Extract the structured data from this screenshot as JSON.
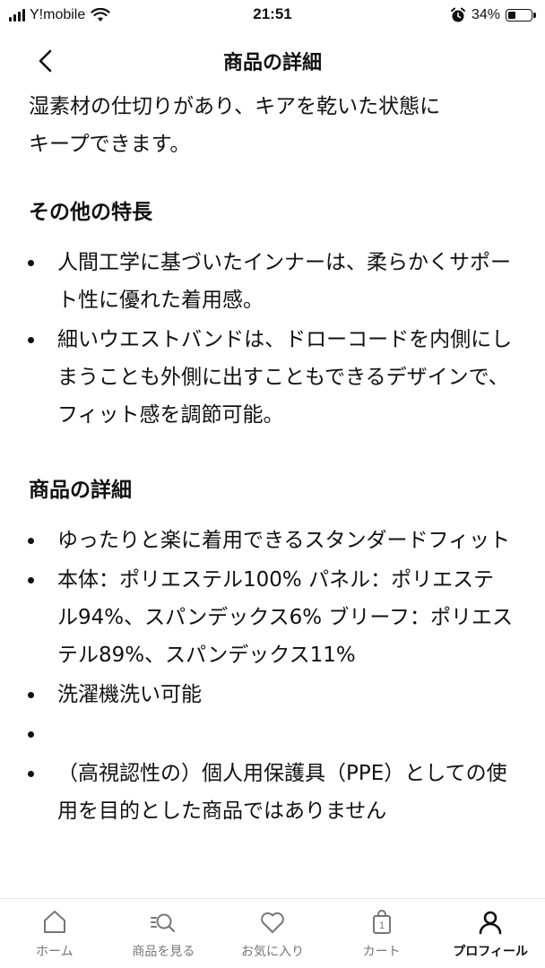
{
  "status_bar": {
    "carrier": "Y!mobile",
    "time": "21:51",
    "battery_percent": "34%",
    "battery_level": 0.34
  },
  "header": {
    "title": "商品の詳細",
    "back_icon": "chevron-left-icon"
  },
  "content": {
    "intro_lines": [
      "湿素材の仕切りがあり、キアを乾いた状態に",
      "キープできます。"
    ],
    "sections": [
      {
        "heading": "その他の特長",
        "items": [
          "人間工学に基づいたインナーは、柔らかくサポート性に優れた着用感。",
          "細いウエストバンドは、ドローコードを内側にしまうことも外側に出すこともできるデザインで、フィット感を調節可能。"
        ]
      },
      {
        "heading": "商品の詳細",
        "items": [
          "ゆったりと楽に着用できるスタンダードフィット",
          "本体：ポリエステル100% パネル：ポリエステル94%、スパンデックス6% ブリーフ：ポリエステル89%、スパンデックス11%",
          "洗濯機洗い可能",
          "",
          "（高視認性の）個人用保護具（PPE）としての使用を目的とした商品ではありません"
        ]
      }
    ]
  },
  "tab_bar": {
    "tabs": [
      {
        "label": "ホーム",
        "icon": "home-icon",
        "active": false
      },
      {
        "label": "商品を見る",
        "icon": "browse-search-icon",
        "active": false
      },
      {
        "label": "お気に入り",
        "icon": "heart-icon",
        "active": false
      },
      {
        "label": "カート",
        "icon": "bag-icon",
        "badge": "1",
        "active": false
      },
      {
        "label": "プロフィール",
        "icon": "profile-icon",
        "active": true
      }
    ]
  }
}
